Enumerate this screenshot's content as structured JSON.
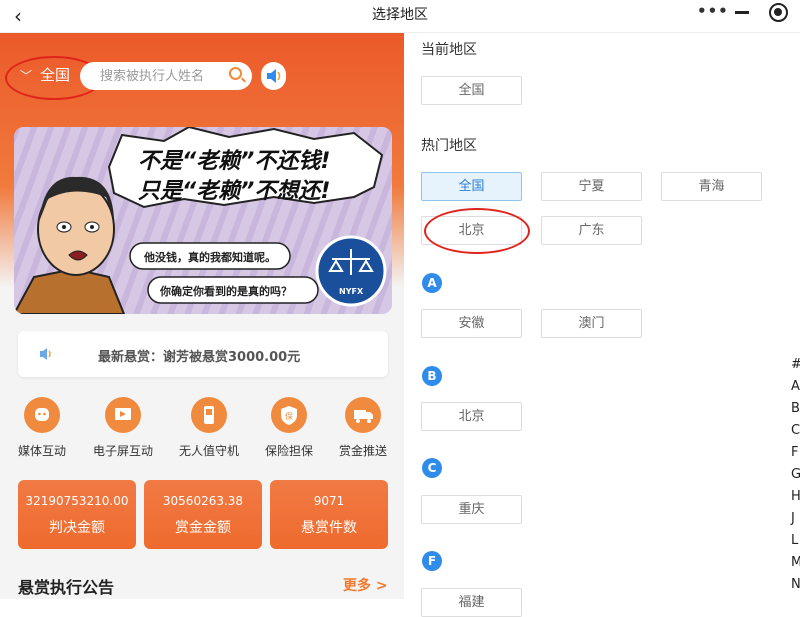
{
  "titlebar": {
    "back": "‹",
    "title": "选择地区",
    "menu_dots": "•••"
  },
  "left": {
    "region_label": "全国",
    "search_placeholder": "搜索被执行人姓名",
    "banner": {
      "line1": "不是“老赖”不还钱!",
      "line2": "只是“老赖”不想还!",
      "bubble1": "他没钱，真的我都知道呢。",
      "bubble2": "你确定你看到的是真的吗？",
      "badge": "NYFX"
    },
    "notice_text": "最新悬赏：谢芳被悬赏3000.00元",
    "icons": [
      {
        "label": "媒体互动"
      },
      {
        "label": "电子屏互动"
      },
      {
        "label": "无人值守机"
      },
      {
        "label": "保险担保"
      },
      {
        "label": "赏金推送"
      }
    ],
    "stats": [
      {
        "value": "32190753210.00",
        "label": "判决金额"
      },
      {
        "value": "30560263.38",
        "label": "赏金金额"
      },
      {
        "value": "9071",
        "label": "悬赏件数"
      }
    ],
    "announce_title": "悬赏执行公告",
    "more_label": "更多 >"
  },
  "right": {
    "current_label": "当前地区",
    "current_value": "全国",
    "hot_label": "热门地区",
    "hot": [
      "全国",
      "宁夏",
      "青海",
      "北京",
      "广东"
    ],
    "groups": [
      {
        "letter": "A",
        "items": [
          "安徽",
          "澳门"
        ]
      },
      {
        "letter": "B",
        "items": [
          "北京"
        ]
      },
      {
        "letter": "C",
        "items": [
          "重庆"
        ]
      },
      {
        "letter": "F",
        "items": [
          "福建"
        ]
      }
    ],
    "index": [
      "#",
      "A",
      "B",
      "C",
      "F",
      "G",
      "H",
      "J",
      "L",
      "M",
      "N"
    ]
  },
  "colors": {
    "accent": "#ef6a2d",
    "annotation": "#e0241b",
    "letter_badge": "#2f8cea"
  }
}
